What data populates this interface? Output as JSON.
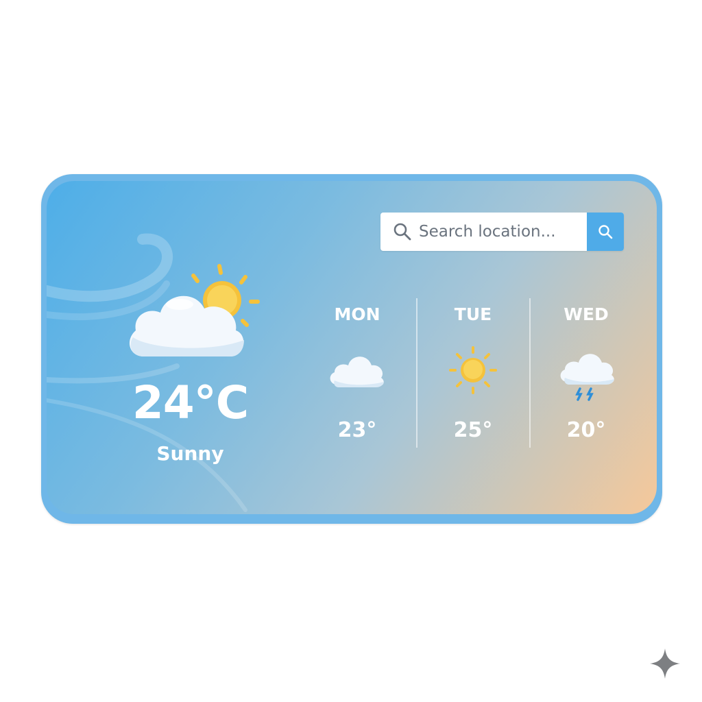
{
  "search": {
    "placeholder": "Search location..."
  },
  "current": {
    "temperature": "24°C",
    "condition": "Sunny",
    "icon": "partly-cloudy-icon"
  },
  "forecast": [
    {
      "day": "MON",
      "temp": "23°",
      "icon": "cloud-icon"
    },
    {
      "day": "TUE",
      "temp": "25°",
      "icon": "sun-icon"
    },
    {
      "day": "WED",
      "temp": "20°",
      "icon": "rain-cloud-icon"
    }
  ],
  "colors": {
    "accent": "#4fabe8",
    "sun": "#f5c23b",
    "card_border": "#6fb7e8",
    "gradient_warm": "#f6c89a"
  }
}
